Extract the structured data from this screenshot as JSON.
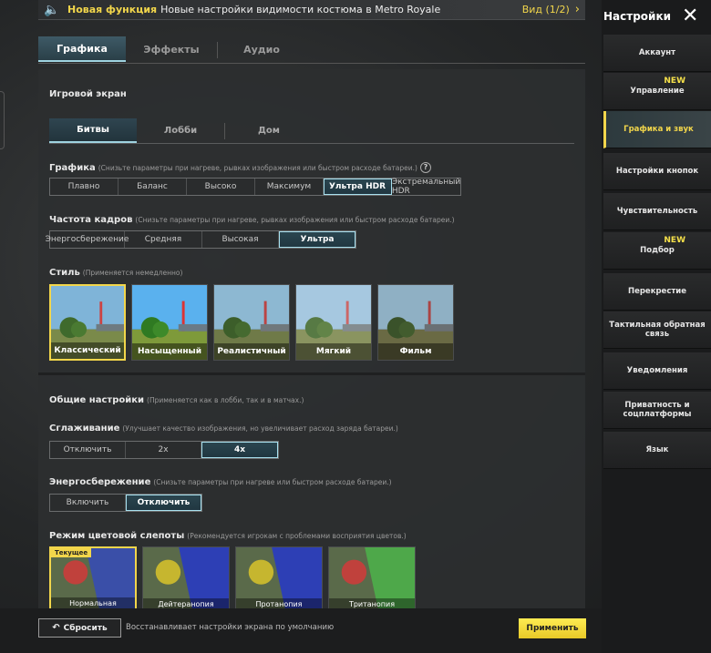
{
  "notification": {
    "label": "Новая функция",
    "text": "Новые настройки видимости костюма в Metro Royale",
    "view": "Вид (1/2)"
  },
  "tabs": [
    "Графика",
    "Эффекты",
    "Аудио"
  ],
  "game_screen": {
    "heading": "Игровой экран",
    "subtabs": [
      "Битвы",
      "Лобби",
      "Дом"
    ]
  },
  "graphics": {
    "label": "Графика",
    "hint": "(Снизьте параметры при нагреве, рывках изображения или быстром расходе батареи.)",
    "options": [
      "Плавно",
      "Баланс",
      "Высоко",
      "Максимум",
      "Ультра HDR",
      "Экстремальный HDR"
    ],
    "selected": "Ультра HDR"
  },
  "fps": {
    "label": "Частота кадров",
    "hint": "(Снизьте параметры при нагреве, рывках изображения или быстром расходе батареи.)",
    "options": [
      "Энергосбережение",
      "Средняя",
      "Высокая",
      "Ультра"
    ],
    "selected": "Ультра"
  },
  "style": {
    "label": "Стиль",
    "hint": "(Применяется немедленно)",
    "options": [
      "Классический",
      "Насыщенный",
      "Реалистичный",
      "Мягкий",
      "Фильм"
    ],
    "selected": "Классический"
  },
  "general": {
    "heading": "Общие настройки",
    "hint": "(Применяется как в лобби, так и в матчах.)"
  },
  "antialiasing": {
    "label": "Сглаживание",
    "hint": "(Улучшает качество изображения, но увеличивает расход заряда батареи.)",
    "options": [
      "Отключить",
      "2x",
      "4x"
    ],
    "selected": "4x"
  },
  "power_saving": {
    "label": "Энергосбережение",
    "hint": "(Снизьте параметры при нагреве или быстром расходе батареи.)",
    "options": [
      "Включить",
      "Отключить"
    ],
    "selected": "Отключить"
  },
  "color_blind": {
    "label": "Режим цветовой слепоты",
    "hint": "(Рекомендуется игрокам с проблемами восприятия цветов.)",
    "current_badge": "Текущее",
    "options": [
      "Нормальная",
      "Дейтеранопия",
      "Протанопия",
      "Тританопия"
    ],
    "selected": "Нормальная"
  },
  "bottom": {
    "reset": "Сбросить",
    "reset_hint": "Восстанавливает настройки экрана по умолчанию",
    "apply": "Применить"
  },
  "sidebar": {
    "title": "Настройки",
    "items": [
      {
        "label": "Аккаунт",
        "new": ""
      },
      {
        "label": "Управление",
        "new": "NEW"
      },
      {
        "label": "Графика и звук",
        "new": ""
      },
      {
        "label": "Настройки кнопок",
        "new": ""
      },
      {
        "label": "Чувствительность",
        "new": ""
      },
      {
        "label": "Подбор",
        "new": "NEW"
      },
      {
        "label": "Перекрестие",
        "new": ""
      },
      {
        "label": "Тактильная обратная связь",
        "new": ""
      },
      {
        "label": "Уведомления",
        "new": ""
      },
      {
        "label": "Приватность и соцплатформы",
        "new": ""
      },
      {
        "label": "Язык",
        "new": ""
      }
    ],
    "active_index": 2
  },
  "colors": {
    "accent": "#f2d64b",
    "active_tab": "#9fd3e0",
    "panel": "#2d2f30"
  }
}
